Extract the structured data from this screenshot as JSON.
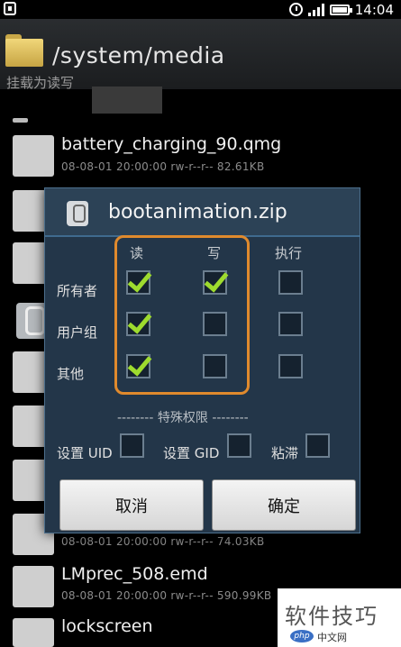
{
  "status_bar": {
    "time": "14:04",
    "icons": [
      "usb-icon",
      "alarm-icon",
      "signal-icon",
      "battery-icon"
    ]
  },
  "header": {
    "path": "/system/media",
    "icon": "folder-icon"
  },
  "mount_label": "挂载为读写",
  "files": [
    {
      "name": "battery_charging_90.qmg",
      "meta": "08-08-01 20:00:00  rw-r--r--  82.61KB"
    },
    {
      "name": "LMprec_508.emd",
      "meta": "08-08-01 20:00:00  rw-r--r--  590.99KB"
    },
    {
      "name": "lockscreen",
      "meta": ""
    }
  ],
  "partial_meta": "08-08-01 20:00:00  rw-r--r--  74.03KB",
  "dialog": {
    "title": "bootanimation.zip",
    "columns": [
      "读",
      "写",
      "执行"
    ],
    "rows": [
      {
        "label": "所有者",
        "read": true,
        "write": true,
        "execute": false
      },
      {
        "label": "用户组",
        "read": true,
        "write": false,
        "execute": false
      },
      {
        "label": "其他",
        "read": true,
        "write": false,
        "execute": false
      }
    ],
    "special_title": "-------- 特殊权限 --------",
    "special": [
      {
        "label": "设置 UID",
        "checked": false
      },
      {
        "label": "设置 GID",
        "checked": false
      },
      {
        "label": "粘滞",
        "checked": false
      }
    ],
    "cancel_label": "取消",
    "ok_label": "确定"
  },
  "watermark": {
    "text": "软件技巧",
    "logo": "php",
    "sub": "中文网"
  }
}
